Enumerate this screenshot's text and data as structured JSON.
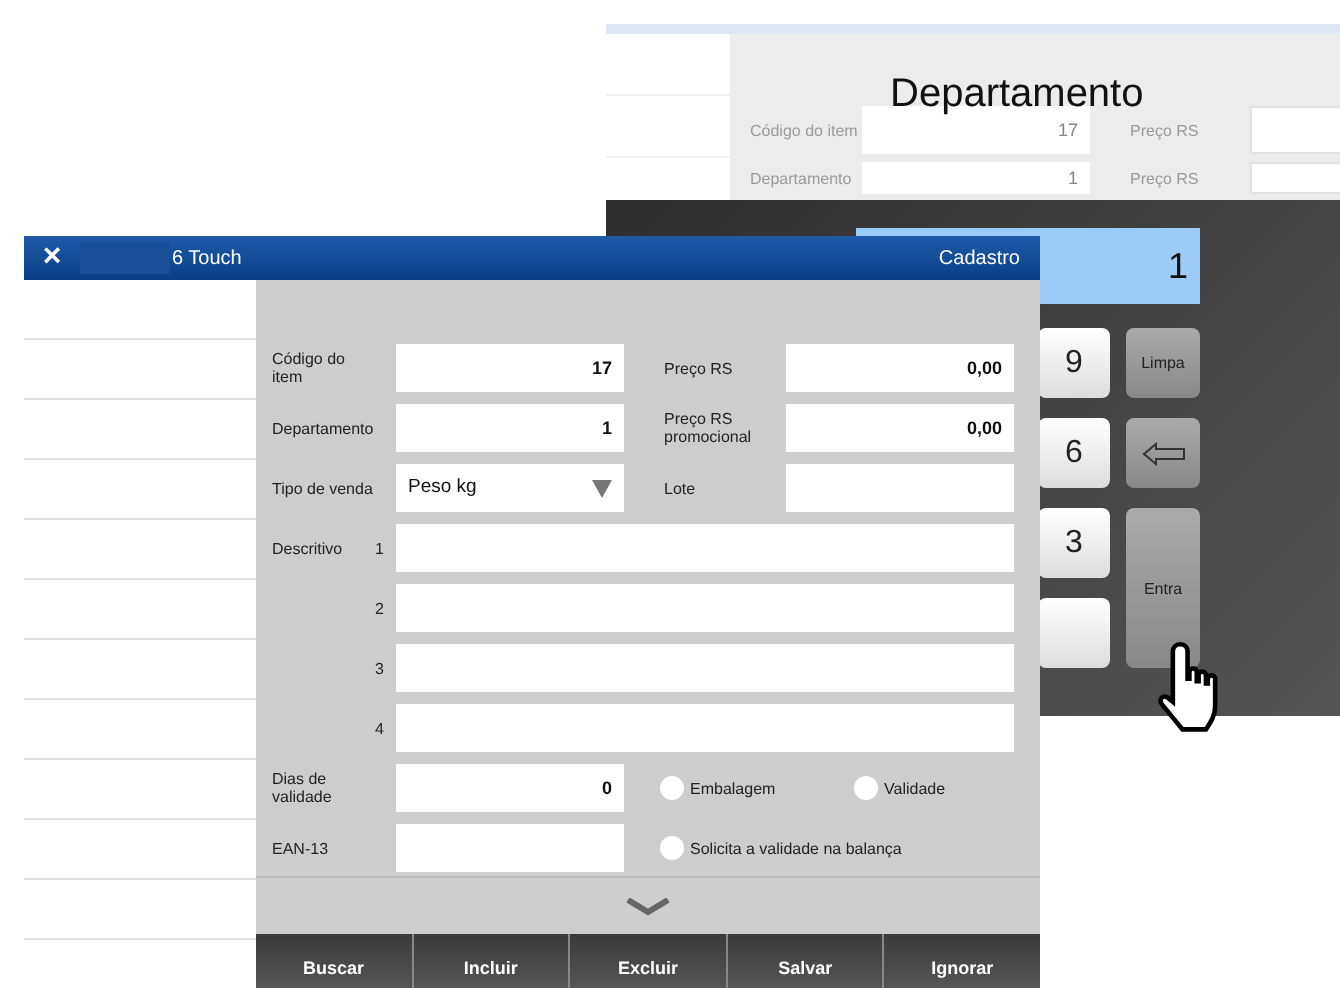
{
  "back_window": {
    "title": "Departamento",
    "faded_rows": [
      {
        "label": "Código do item",
        "value": "17",
        "label_2": "Preço RS"
      },
      {
        "label": "Departamento",
        "value": "1",
        "label_2": "Preço RS"
      }
    ],
    "keypad": {
      "display": "1",
      "keys": [
        {
          "kind": "digit",
          "label": "9"
        },
        {
          "kind": "action",
          "label": "Limpa"
        },
        {
          "kind": "digit",
          "label": "6"
        },
        {
          "kind": "backspace"
        },
        {
          "kind": "digit",
          "label": "3"
        },
        {
          "kind": "enter",
          "label": "Entra"
        },
        {
          "kind": "blank"
        }
      ]
    }
  },
  "front_window": {
    "title": "6 Touch",
    "close": "×",
    "section": "Cadastro",
    "form": {
      "rows": [
        {
          "kind": "pair",
          "label": "Código do item",
          "value": "17",
          "label_2": "Preço RS",
          "value_2": "0,00"
        },
        {
          "kind": "pair",
          "label": "Departamento",
          "value": "1",
          "label_2": "Preço RS promocional",
          "value_2": "0,00"
        },
        {
          "kind": "select",
          "label": "Tipo de venda",
          "value": "Peso kg",
          "label_2": "Lote"
        },
        {
          "kind": "wide",
          "label": "Descritivo",
          "number": "1"
        },
        {
          "kind": "wide",
          "number": "2"
        },
        {
          "kind": "wide",
          "number": "3"
        },
        {
          "kind": "wide",
          "number": "4"
        },
        {
          "kind": "radios",
          "label": "Dias de validade",
          "value": "0",
          "options": [
            {
              "label": "Embalagem",
              "checked": false
            },
            {
              "label": "Validade",
              "checked": false
            }
          ]
        },
        {
          "kind": "radios",
          "label": "EAN-13",
          "options": [
            {
              "label": "Solicita a validade na balança",
              "checked": false
            }
          ]
        }
      ]
    },
    "buttons": [
      "Buscar",
      "Incluir",
      "Excluir",
      "Salvar",
      "Ignorar"
    ]
  }
}
